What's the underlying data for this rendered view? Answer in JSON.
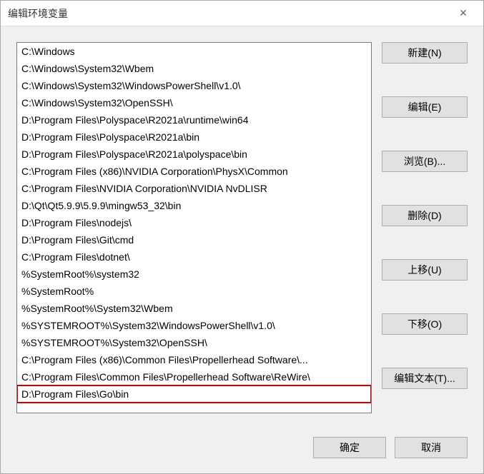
{
  "dialog": {
    "title": "编辑环境变量"
  },
  "list": {
    "items": [
      "C:\\Windows",
      "C:\\Windows\\System32\\Wbem",
      "C:\\Windows\\System32\\WindowsPowerShell\\v1.0\\",
      "C:\\Windows\\System32\\OpenSSH\\",
      "D:\\Program Files\\Polyspace\\R2021a\\runtime\\win64",
      "D:\\Program Files\\Polyspace\\R2021a\\bin",
      "D:\\Program Files\\Polyspace\\R2021a\\polyspace\\bin",
      "C:\\Program Files (x86)\\NVIDIA Corporation\\PhysX\\Common",
      "C:\\Program Files\\NVIDIA Corporation\\NVIDIA NvDLISR",
      "D:\\Qt\\Qt5.9.9\\5.9.9\\mingw53_32\\bin",
      "D:\\Program Files\\nodejs\\",
      "D:\\Program Files\\Git\\cmd",
      "C:\\Program Files\\dotnet\\",
      "%SystemRoot%\\system32",
      "%SystemRoot%",
      "%SystemRoot%\\System32\\Wbem",
      "%SYSTEMROOT%\\System32\\WindowsPowerShell\\v1.0\\",
      "%SYSTEMROOT%\\System32\\OpenSSH\\",
      "C:\\Program Files (x86)\\Common Files\\Propellerhead Software\\...",
      "C:\\Program Files\\Common Files\\Propellerhead Software\\ReWire\\",
      "D:\\Program Files\\Go\\bin"
    ],
    "highlighted_index": 20
  },
  "buttons": {
    "new": "新建(N)",
    "edit": "编辑(E)",
    "browse": "浏览(B)...",
    "delete": "删除(D)",
    "move_up": "上移(U)",
    "move_down": "下移(O)",
    "edit_text": "编辑文本(T)...",
    "ok": "确定",
    "cancel": "取消"
  }
}
